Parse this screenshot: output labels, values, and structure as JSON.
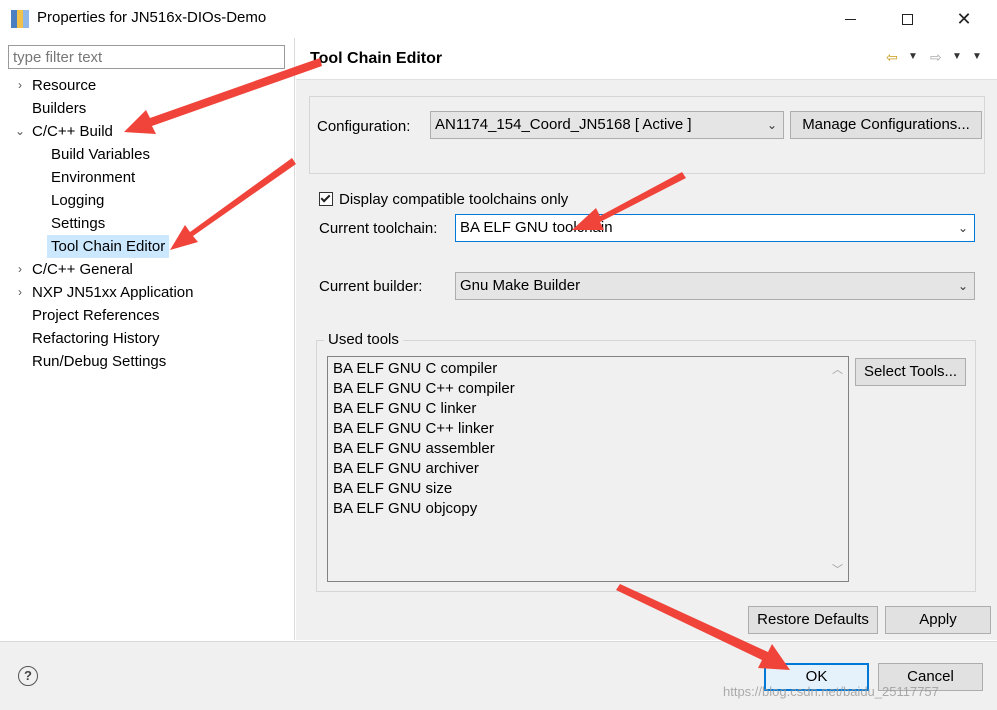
{
  "window": {
    "title": "Properties for JN516x-DIOs-Demo",
    "minimize_glyph": "",
    "close_glyph": "✕"
  },
  "filter": {
    "placeholder": "type filter text"
  },
  "tree": {
    "items": [
      {
        "label": "Resource",
        "expandable": true,
        "expanded": false,
        "depth": 0
      },
      {
        "label": "Builders",
        "expandable": false,
        "depth": 0
      },
      {
        "label": "C/C++ Build",
        "expandable": true,
        "expanded": true,
        "depth": 0
      },
      {
        "label": "Build Variables",
        "expandable": false,
        "depth": 1
      },
      {
        "label": "Environment",
        "expandable": false,
        "depth": 1
      },
      {
        "label": "Logging",
        "expandable": false,
        "depth": 1
      },
      {
        "label": "Settings",
        "expandable": false,
        "depth": 1
      },
      {
        "label": "Tool Chain Editor",
        "expandable": false,
        "depth": 1,
        "selected": true
      },
      {
        "label": "C/C++ General",
        "expandable": true,
        "expanded": false,
        "depth": 0
      },
      {
        "label": "NXP JN51xx Application",
        "expandable": true,
        "expanded": false,
        "depth": 0
      },
      {
        "label": "Project References",
        "expandable": false,
        "depth": 0
      },
      {
        "label": "Refactoring History",
        "expandable": false,
        "depth": 0
      },
      {
        "label": "Run/Debug Settings",
        "expandable": false,
        "depth": 0
      }
    ]
  },
  "page": {
    "title": "Tool Chain Editor",
    "nav_icons": [
      "back-arrow-icon",
      "forward-arrow-icon",
      "view-menu-icon"
    ]
  },
  "configuration": {
    "label": "Configuration:",
    "value": "AN1174_154_Coord_JN5168  [ Active ]",
    "manage_label": "Manage Configurations..."
  },
  "toolchain": {
    "compatible_only_label": "Display compatible toolchains only",
    "compatible_only_checked": true,
    "current_toolchain_label": "Current toolchain:",
    "current_toolchain_value": "BA ELF GNU toolchain",
    "current_builder_label": "Current builder:",
    "current_builder_value": "Gnu Make Builder"
  },
  "used_tools": {
    "title": "Used tools",
    "items": [
      "BA ELF GNU C compiler",
      "BA ELF GNU C++ compiler",
      "BA ELF GNU C linker",
      "BA ELF GNU C++ linker",
      "BA ELF GNU assembler",
      "BA ELF GNU archiver",
      "BA ELF GNU size",
      "BA ELF GNU objcopy"
    ],
    "select_tools_label": "Select Tools..."
  },
  "actions": {
    "restore_defaults_label": "Restore Defaults",
    "apply_label": "Apply",
    "ok_label": "OK",
    "cancel_label": "Cancel",
    "help_glyph": "?"
  },
  "watermark": "https://blog.csdn.net/baidu_25117757",
  "colors": {
    "accent": "#0078d7",
    "selection": "#cce8ff",
    "annotation_arrow": "#f0443a"
  }
}
